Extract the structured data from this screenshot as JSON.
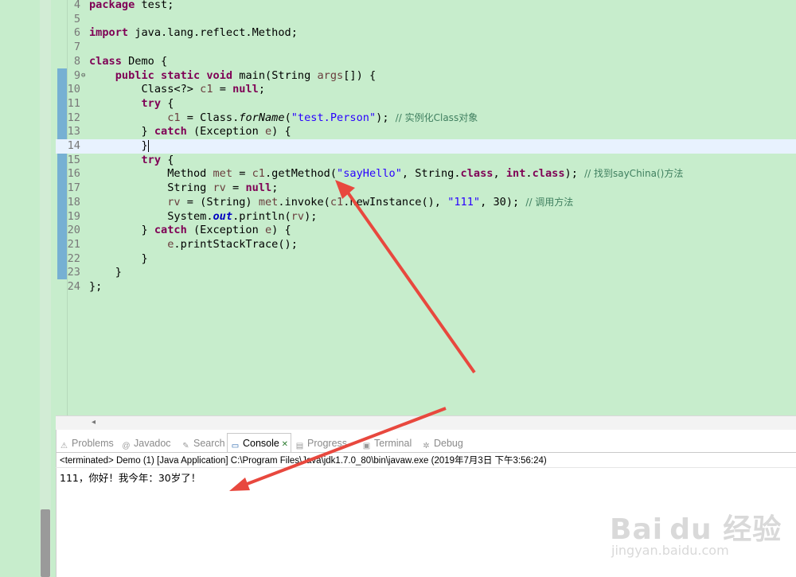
{
  "editor": {
    "lines": [
      {
        "n": "4",
        "html": "<span class=\"kw\">package</span> test;"
      },
      {
        "n": "5",
        "html": ""
      },
      {
        "n": "6",
        "html": "<span class=\"kw\">import</span> java.lang.reflect.Method;"
      },
      {
        "n": "7",
        "html": ""
      },
      {
        "n": "8",
        "html": "<span class=\"kw\">class</span> Demo {"
      },
      {
        "n": "9",
        "html": "    <span class=\"kw\">public</span> <span class=\"kw\">static</span> <span class=\"kw\">void</span> main(String <span class=\"var\">args</span>[]) {"
      },
      {
        "n": "10",
        "html": "        Class&lt;?&gt; <span class=\"var\">c1</span> = <span class=\"kw\">null</span>;"
      },
      {
        "n": "11",
        "html": "        <span class=\"kw\">try</span> {"
      },
      {
        "n": "12",
        "html": "            <span class=\"var\">c1</span> = Class.<span class=\"ital\">forName</span>(<span class=\"str\">\"test.Person\"</span>); <span class=\"cm\">// 实例化Class对象</span>"
      },
      {
        "n": "13",
        "html": "        } <span class=\"kw\">catch</span> (Exception <span class=\"var\">e</span>) {"
      },
      {
        "n": "14",
        "html": "        }<span class=\"caret\"></span>"
      },
      {
        "n": "15",
        "html": "        <span class=\"kw\">try</span> {"
      },
      {
        "n": "16",
        "html": "            Method <span class=\"var\">met</span> = <span class=\"var\">c1</span>.getMethod(<span class=\"str\">\"sayHello\"</span>, String.<span class=\"kw\">class</span>, <span class=\"kw\">int</span>.<span class=\"kw\">class</span>); <span class=\"cm\">// 找到sayChina()方法</span>"
      },
      {
        "n": "17",
        "html": "            String <span class=\"var\">rv</span> = <span class=\"kw\">null</span>;"
      },
      {
        "n": "18",
        "html": "            <span class=\"var\">rv</span> = (String) <span class=\"var\">met</span>.invoke(<span class=\"var\">c1</span>.newInstance(), <span class=\"str\">\"111\"</span>, 30); <span class=\"cm\">// 调用方法</span>"
      },
      {
        "n": "19",
        "html": "            System.<span class=\"fld\">out</span>.println(<span class=\"var\">rv</span>);"
      },
      {
        "n": "20",
        "html": "        } <span class=\"kw\">catch</span> (Exception <span class=\"var\">e</span>) {"
      },
      {
        "n": "21",
        "html": "            <span class=\"var\">e</span>.printStackTrace();"
      },
      {
        "n": "22",
        "html": "        }"
      },
      {
        "n": "23",
        "html": "    }"
      },
      {
        "n": "24",
        "html": "};"
      }
    ],
    "current_line": "14",
    "fold_marker_line": "9",
    "scroll_left_glyph": "◂"
  },
  "console": {
    "tabs": [
      {
        "label": "Problems",
        "icon": "problems-icon",
        "glyph": "⚠"
      },
      {
        "label": "Javadoc",
        "icon": "javadoc-icon",
        "glyph": "@"
      },
      {
        "label": "Search",
        "icon": "search-icon",
        "glyph": "✎"
      },
      {
        "label": "Console",
        "icon": "console-icon",
        "glyph": "▭",
        "close": "✕"
      },
      {
        "label": "Progress",
        "icon": "progress-icon",
        "glyph": "▤"
      },
      {
        "label": "Terminal",
        "icon": "terminal-icon",
        "glyph": "▣"
      },
      {
        "label": "Debug",
        "icon": "debug-icon",
        "glyph": "✲"
      }
    ],
    "active_tab": "Console",
    "status": "<terminated> Demo (1) [Java Application] C:\\Program Files\\Java\\jdk1.7.0_80\\bin\\javaw.exe (2019年7月3日 下午3:56:24)",
    "output": "111，你好！我今年：30岁了！"
  },
  "watermark": {
    "logo": "Bai du 经验",
    "url": "jingyan.baidu.com"
  },
  "colors": {
    "editor_bg": "#c7edcc",
    "arrow": "#e8483e"
  }
}
